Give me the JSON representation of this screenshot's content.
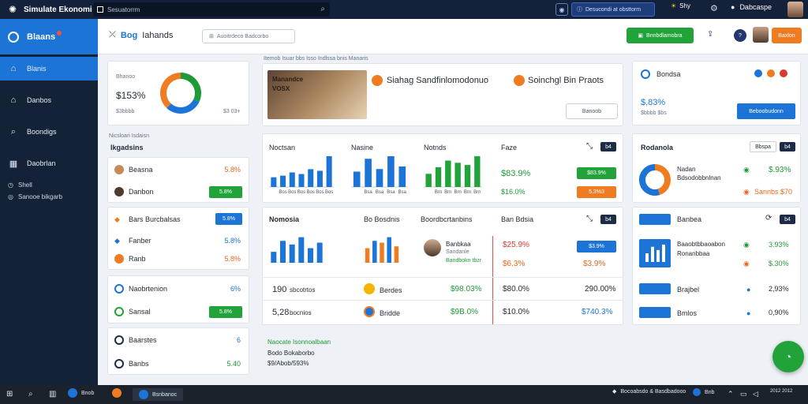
{
  "topbar": {
    "title": "Simulate Ekonomi",
    "search_placeholder": "Sesuatorrm",
    "notify_text": "Desucondi at obsttorm",
    "weather_label": "Shy",
    "account_label": "Dabcaspe",
    "logo_icon": "brand-icon"
  },
  "sidebar": {
    "brand": "Blaans",
    "items": [
      {
        "label": "Blanis",
        "icon": "home-icon"
      },
      {
        "label": "Danbos",
        "icon": "house-icon"
      },
      {
        "label": "Boondigs",
        "icon": "search-icon"
      },
      {
        "label": "Daobrlan",
        "icon": "calendar-icon"
      }
    ],
    "sub_items": [
      {
        "label": "Shell"
      },
      {
        "label": "Sanooe bikgarb"
      }
    ]
  },
  "header": {
    "title_prefix": "Bog",
    "title": "Iahands",
    "field_text": "Auoitrdeco Badcorbo",
    "green_button": "Bnnbdlamobra",
    "orange_button": "Baxlon"
  },
  "summary": {
    "label": "Bhanoo",
    "value": "$153%",
    "footnote": "$3bbbb",
    "right_note": "$3 03+",
    "donut": {
      "segments": [
        0.32,
        0.3,
        0.38
      ],
      "colors": [
        "#1e9a36",
        "#1b74d6",
        "#f07c22"
      ]
    }
  },
  "left_list": {
    "caption": "Nicsloari Isdaisn",
    "heading": "Ikgadsins",
    "group1": [
      {
        "label": "Beasna",
        "value": "5.8%",
        "type": "text-orange"
      },
      {
        "label": "Danbon",
        "value": "5.8%",
        "type": "pill-green"
      }
    ],
    "group2": [
      {
        "label": "Bars Burcbalsas",
        "value": "5.8%",
        "type": "pill-blue"
      },
      {
        "label": "Fanber",
        "value": "5.8%",
        "type": "text-blue"
      },
      {
        "label": "Ranb",
        "value": "5.8%",
        "type": "text-orange"
      }
    ],
    "group3": [
      {
        "label": "Naobrtenion",
        "value": "6%",
        "type": "text-blue"
      },
      {
        "label": "Sansal",
        "value": "5.8%",
        "type": "pill-green"
      }
    ],
    "group4": [
      {
        "label": "Baarstes",
        "value": "6",
        "type": "text-blue"
      },
      {
        "label": "Banbs",
        "value": "5.40",
        "type": "text-green"
      }
    ]
  },
  "banner": {
    "caption": "Itemob Isuar bbs Isso Indlssa bnis Manaris",
    "image_text": "Manandce VOSX",
    "title_left": "Siahag Sandfinlomodonuo",
    "title_right": "Soinchgl Bin Praots",
    "button": "Banoob"
  },
  "chart_panel": {
    "labels": [
      "Noctsan",
      "Nasine",
      "Notnds",
      "Faze"
    ],
    "values": [
      "$83.9%",
      "$16.0%"
    ],
    "pills": [
      "$83.9%",
      "5.3%3"
    ],
    "tag": "b4",
    "chart_data": [
      {
        "type": "bar",
        "categories": [
          "",
          "Bos",
          "Bos",
          "Bos",
          "Bos",
          "Bos",
          "Bos"
        ],
        "values": [
          30,
          35,
          45,
          40,
          55,
          50,
          95
        ],
        "colors": [
          "#1b74d6"
        ]
      },
      {
        "type": "bar",
        "categories": [
          "",
          "Bsa",
          "Bsa",
          "Bsa",
          "Bsa"
        ],
        "values": [
          30,
          55,
          35,
          60,
          40
        ],
        "colors": [
          "#1b74d6"
        ]
      },
      {
        "type": "bar",
        "categories": [
          "",
          "Brn",
          "Brn",
          "Brn",
          "Brn",
          "Brn"
        ],
        "values": [
          30,
          45,
          60,
          55,
          50,
          70
        ],
        "colors": [
          "#22a33a"
        ]
      }
    ]
  },
  "table_panel": {
    "headers": [
      "Nomosia",
      "Bo Bosdnis",
      "Boordbcrtanbins",
      "Ban Bdsia"
    ],
    "tag": "b4",
    "person_name": "Banbkaa",
    "person_role": "Sandanle",
    "person_note": "Bandbokn tbzr",
    "values": [
      "$25.9%",
      "$6.3%"
    ],
    "right_pills": [
      "$3.9%",
      "$3.9%"
    ],
    "rows": [
      {
        "num": "190",
        "label": "sbcotrtos",
        "name": "Berdes",
        "val1": "$98.03%",
        "val2": "$80.0%",
        "val3": "290.00%"
      },
      {
        "num": "5,28",
        "label": "bocnios",
        "name": "Bridde",
        "val1": "$9B.0%",
        "val2": "$10.0%",
        "val3": "$740.3%"
      }
    ],
    "chart_data": [
      {
        "type": "bar",
        "categories": [
          "",
          "",
          "",
          "",
          "",
          ""
        ],
        "values": [
          30,
          60,
          50,
          70,
          40,
          55
        ],
        "colors": [
          "#1b74d6"
        ]
      },
      {
        "type": "bar",
        "categories": [
          "",
          "",
          "",
          "",
          ""
        ],
        "values": [
          40,
          60,
          55,
          70,
          45
        ],
        "colors": [
          "#f07c22",
          "#1b74d6"
        ]
      }
    ]
  },
  "bottom_note": {
    "heading": "Naocate Isonnoalbaan",
    "line1": "Bodo Bokaborbo",
    "line2": "$9/Abob/593%"
  },
  "right_panel": {
    "top_label": "Bondsa",
    "top_value": "$,83%",
    "top_note": "$bbbb $bs",
    "top_button": "Beboobudonn",
    "mid_label": "Rodanola",
    "mid_button": "Bbspa",
    "mid_tag": "b4",
    "mid_line1": "Nadan",
    "mid_line2": "Bdsodobbnlnan",
    "mid_value": "$.93%",
    "mid_value2": "Sannbs $70",
    "list_tag": "b4",
    "list_header": "Banbea",
    "tile_line1": "Baaobtbbaoabon",
    "tile_line2": "Ronanbbaa",
    "tile_value": "3.93%",
    "tile_value2": "$.30%",
    "rows": [
      {
        "label": "Brajbel",
        "value": "2,93%"
      },
      {
        "label": "Bmlos",
        "value": "0,90%"
      }
    ],
    "donut": {
      "segments": [
        0.45,
        0.55
      ],
      "colors": [
        "#f07c22",
        "#1b74d6"
      ]
    },
    "tile_bars": [
      40,
      70,
      55,
      80
    ]
  },
  "taskbar": {
    "apps": [
      {
        "label": "Bnob"
      },
      {
        "label": ""
      },
      {
        "label": "Bsnbanoc"
      }
    ],
    "tray_text": "Bocoabsdo & Basdbadooo",
    "tray_label": "Bnb",
    "clock": "2012 2012"
  }
}
